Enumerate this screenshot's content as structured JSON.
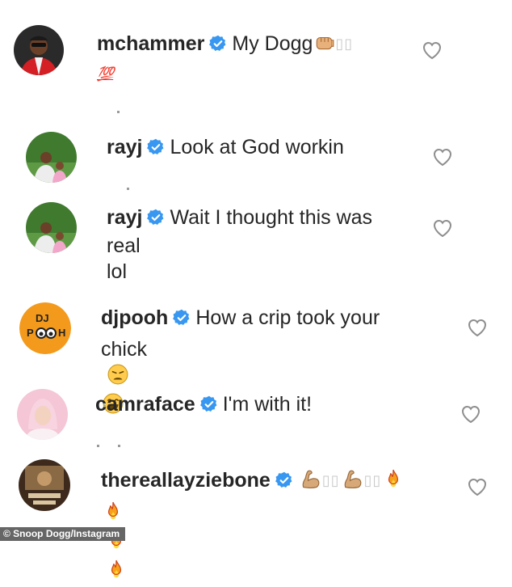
{
  "comments": [
    {
      "username": "mchammer",
      "text": "My Dogg",
      "text_line2": "💯"
    },
    {
      "username": "rayj",
      "text": "Look at God workin"
    },
    {
      "username": "rayj",
      "text": "Wait I thought this was",
      "text_line2": "real lol"
    },
    {
      "username": "djpooh",
      "text": "How a crip took your",
      "text_line2": "chick",
      "avatar_label": "DJ POOH"
    },
    {
      "username": "camraface",
      "text": "I'm with it!"
    },
    {
      "username": "thereallayziebone",
      "text": ""
    }
  ],
  "credit": "© Snoop Dogg/Instagram",
  "icons": {
    "verified": "verified-badge-icon",
    "like": "heart-outline-icon",
    "emoji_fist": "fist-emoji",
    "emoji_hundred": "hundred-points-emoji",
    "emoji_weary": "weary-face-emoji",
    "emoji_laugh": "tears-of-joy-emoji",
    "emoji_muscle": "flexed-biceps-emoji",
    "emoji_fire": "fire-emoji"
  },
  "colors": {
    "verified_blue": "#3897f0",
    "text": "#262626",
    "heart_outline": "#8e8e8e"
  }
}
